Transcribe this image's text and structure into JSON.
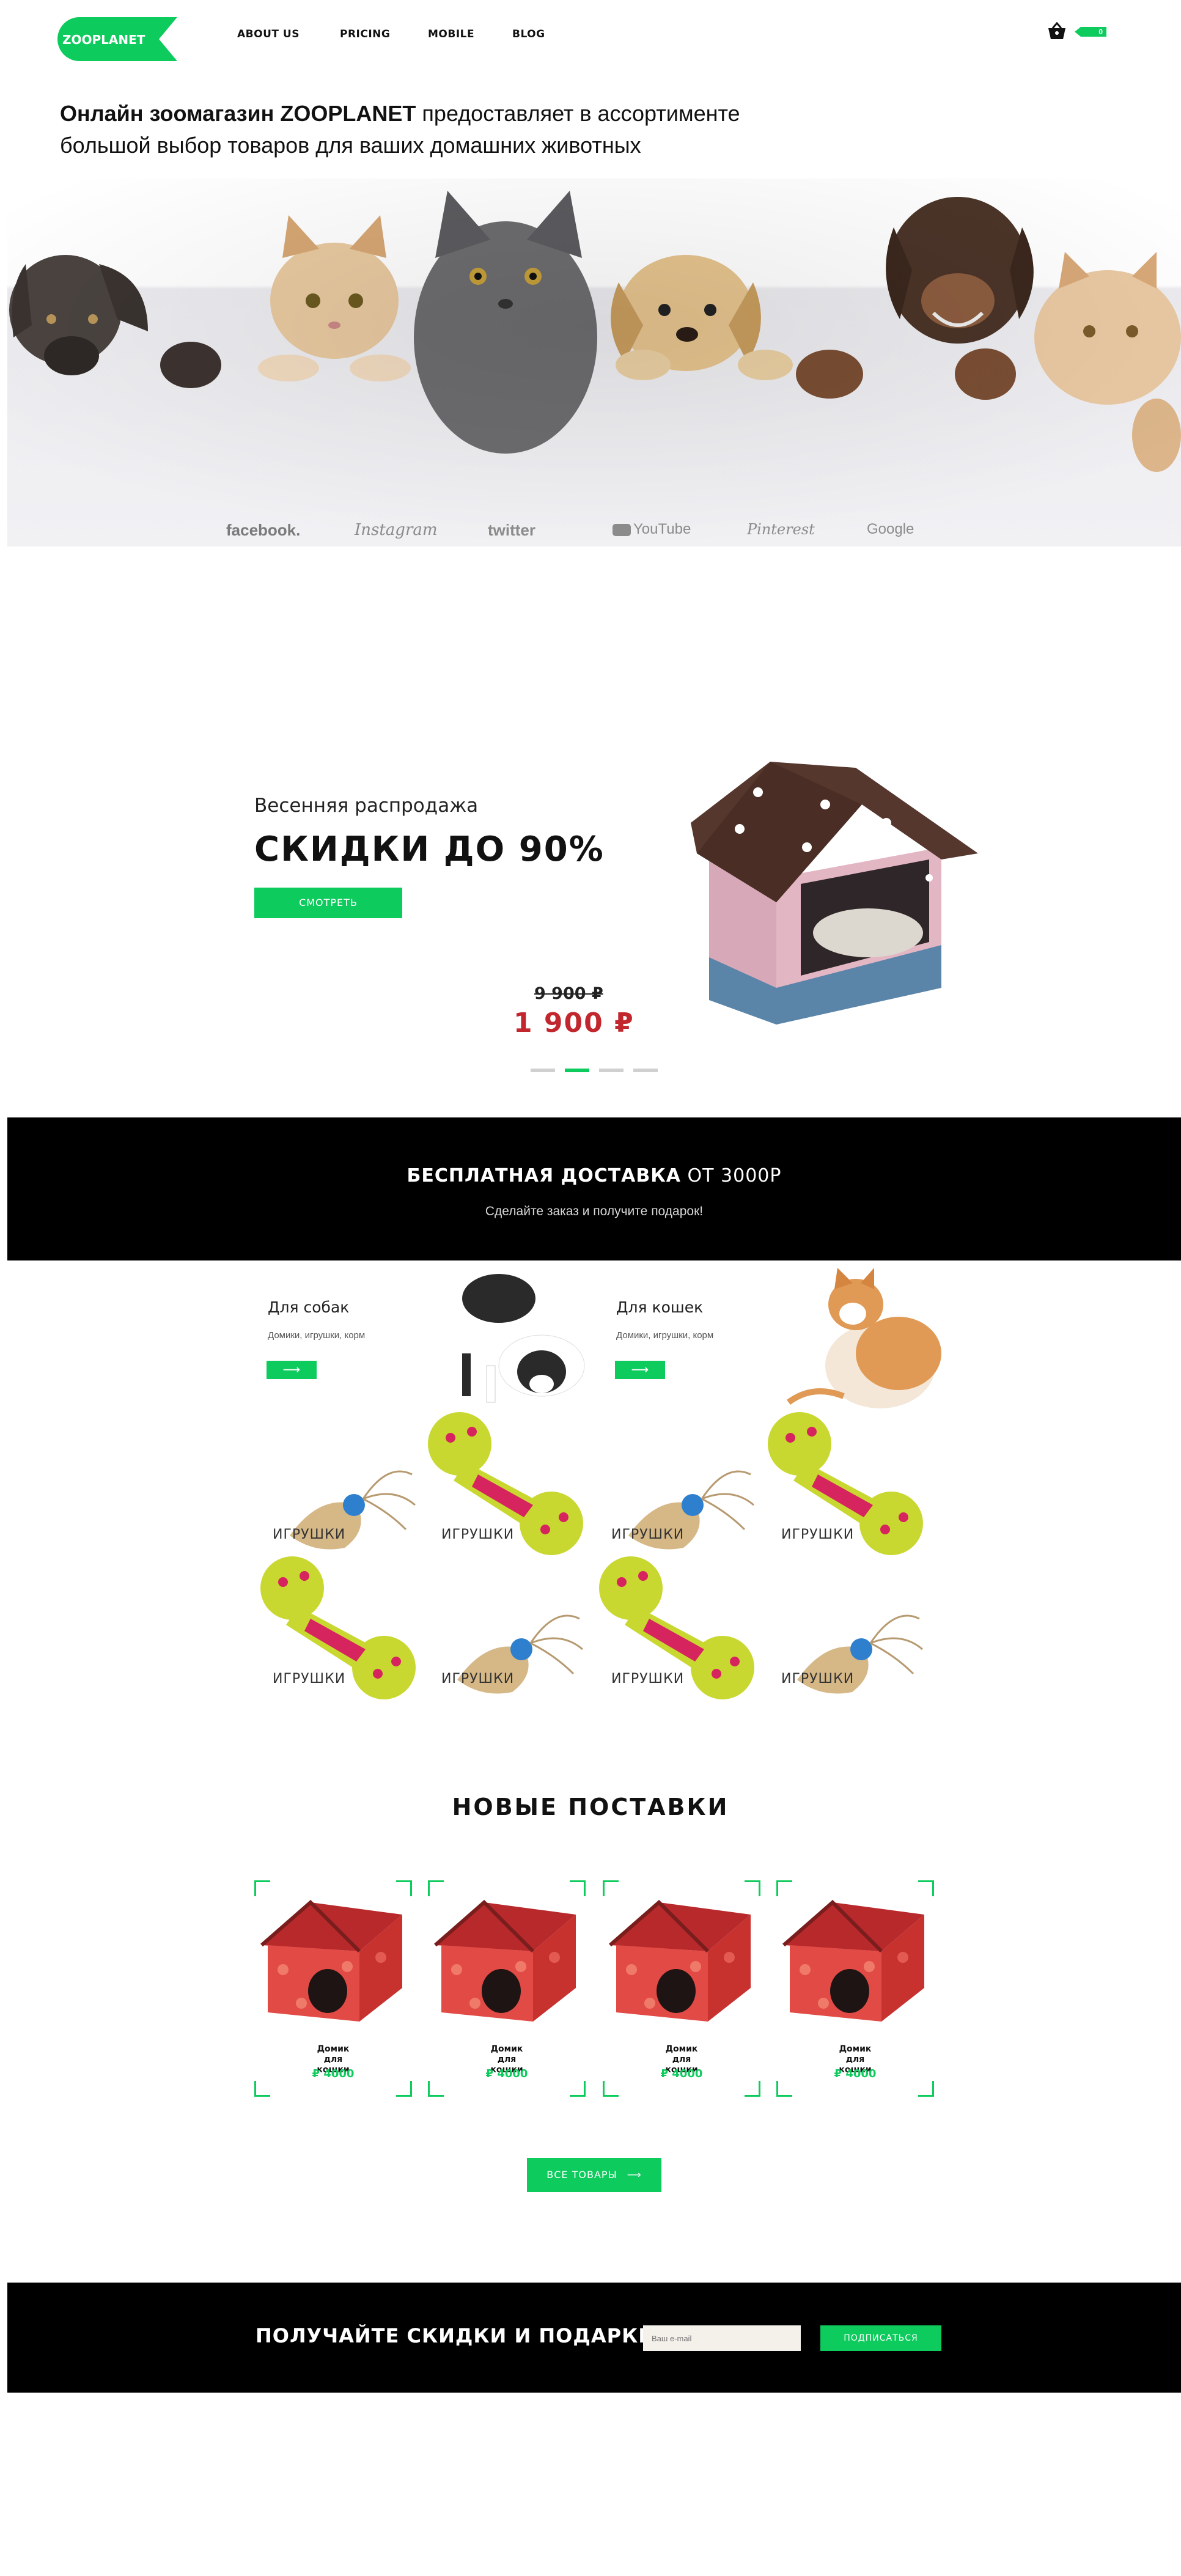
{
  "header": {
    "logo_text": "ZOOPLANET",
    "nav": [
      "ABOUT US",
      "PRICING",
      "MOBILE",
      "BLOG"
    ],
    "cart_count": "0"
  },
  "intro": {
    "bold": "Онлайн зоомагазин ZOOPLANET",
    "rest": " предоставляет в ассортименте",
    "line2": "большой выбор товаров для ваших домашних животных"
  },
  "brands": [
    "facebook.",
    "Instagram",
    "twitter",
    "YouTube",
    "Pinterest",
    "Google"
  ],
  "promo": {
    "subtitle": "Весенняя распродажа",
    "title": "СКИДКИ ДО 90%",
    "button": "СМОТРЕТЬ",
    "old_price": "9 900 ₽",
    "new_price": "1 900 ₽",
    "slides": 4,
    "active_slide": 2
  },
  "delivery": {
    "title_bold": "БЕСПЛАТНАЯ ДОСТАВКА",
    "title_rest": " ОТ 3000Р",
    "subtitle": "Сделайте заказ и получите подарок!"
  },
  "categories": [
    {
      "title": "Для собак",
      "subtitle": "Домики, игрушки, корм",
      "arrow": "⟶"
    },
    {
      "title": "Для кошек",
      "subtitle": "Домики, игрушки, корм",
      "arrow": "⟶"
    }
  ],
  "toy_grid": {
    "label": "ИГРУШКИ"
  },
  "new_arrivals": {
    "title": "НОВЫЕ ПОСТАВКИ",
    "products": [
      {
        "name": "Домик для кошки",
        "price": "₽ 4000"
      },
      {
        "name": "Домик для кошки",
        "price": "₽ 4000"
      },
      {
        "name": "Домик для кошки",
        "price": "₽ 4000"
      },
      {
        "name": "Домик для кошки",
        "price": "₽ 4000"
      }
    ],
    "all_button": "ВСЕ ТОВАРЫ",
    "all_arrow": "⟶"
  },
  "subscribe": {
    "title": "ПОЛУЧАЙТЕ СКИДКИ И ПОДАРКИ",
    "placeholder": "Ваш e-mail",
    "button": "ПОДПИСАТЬСЯ"
  },
  "colors": {
    "accent": "#0ecb5d",
    "price_red": "#c1272d",
    "dark": "#000000"
  }
}
